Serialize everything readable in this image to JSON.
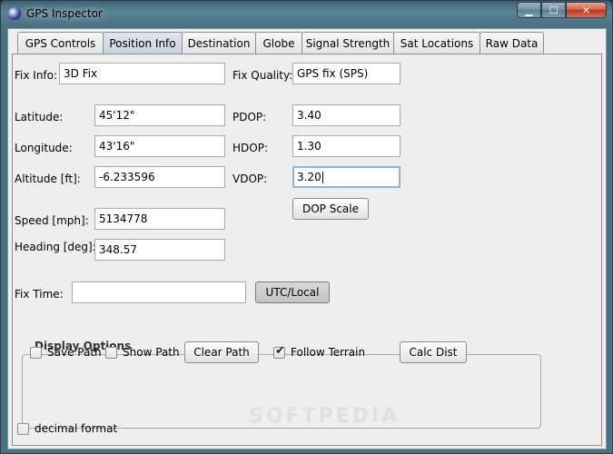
{
  "window": {
    "title": "GPS Inspector",
    "close_glyph": "✕",
    "min_glyph": "▁",
    "max_glyph": "☐"
  },
  "tabs": [
    {
      "label": "GPS Controls"
    },
    {
      "label": "Position Info"
    },
    {
      "label": "Destination"
    },
    {
      "label": "Globe"
    },
    {
      "label": "Signal Strength"
    },
    {
      "label": "Sat Locations"
    },
    {
      "label": "Raw Data"
    }
  ],
  "position": {
    "fix_info_label": "Fix Info:",
    "fix_info_value": "3D Fix",
    "fix_quality_label": "Fix Quality:",
    "fix_quality_value": "GPS fix (SPS)",
    "latitude_label": "Latitude:",
    "latitude_value": "45'12\"",
    "longitude_label": "Longitude:",
    "longitude_value": "43'16\"",
    "altitude_label": "Altitude [ft]:",
    "altitude_value": "-6.233596",
    "pdop_label": "PDOP:",
    "pdop_value": "3.40",
    "hdop_label": "HDOP:",
    "hdop_value": "1.30",
    "vdop_label": "VDOP:",
    "vdop_value": "3.20",
    "dop_scale_button": "DOP Scale",
    "speed_label": "Speed [mph]:",
    "speed_value": "5134778",
    "heading_label": "Heading [deg]:",
    "heading_value": "348.57",
    "fix_time_label": "Fix Time:",
    "fix_time_value": "",
    "utc_local_button": "UTC/Local"
  },
  "display_options": {
    "title": "Display Options",
    "save_path_label": "Save Path",
    "save_path_checked": false,
    "show_path_label": "Show Path",
    "show_path_checked": false,
    "clear_path_button": "Clear Path",
    "follow_terrain_label": "Follow Terrain",
    "follow_terrain_checked": true,
    "calc_dist_button": "Calc Dist"
  },
  "decimal_format_label": "decimal format",
  "decimal_format_checked": false,
  "watermark": "SOFTPEDIA",
  "check_glyph": "✔"
}
